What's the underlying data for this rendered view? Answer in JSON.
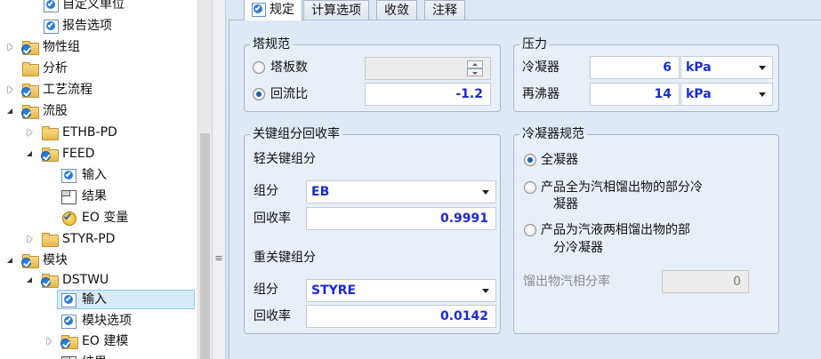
{
  "tree": {
    "items": [
      {
        "label": "自定义单位",
        "icon": "doc-check-icon",
        "expander": "none"
      },
      {
        "label": "报告选项",
        "icon": "doc-check-icon",
        "expander": "none"
      },
      {
        "label": "物性组",
        "icon": "folder-check-icon",
        "expander": "closed"
      },
      {
        "label": "分析",
        "icon": "folder-icon",
        "expander": "none"
      },
      {
        "label": "工艺流程",
        "icon": "folder-check-icon",
        "expander": "closed"
      },
      {
        "label": "流股",
        "icon": "folder-check-icon",
        "expander": "open"
      },
      {
        "label": "ETHB-PD",
        "icon": "folder-icon",
        "expander": "closed"
      },
      {
        "label": "FEED",
        "icon": "folder-check-icon",
        "expander": "open"
      },
      {
        "label": "输入",
        "icon": "doc-check-icon",
        "expander": "none"
      },
      {
        "label": "结果",
        "icon": "results-icon",
        "expander": "none"
      },
      {
        "label": "EO 变量",
        "icon": "eo-check-icon",
        "expander": "none"
      },
      {
        "label": "STYR-PD",
        "icon": "folder-icon",
        "expander": "closed"
      },
      {
        "label": "模块",
        "icon": "folder-check-icon",
        "expander": "open"
      },
      {
        "label": "DSTWU",
        "icon": "folder-check-icon",
        "expander": "open"
      },
      {
        "label": "输入",
        "icon": "doc-check-icon",
        "expander": "none",
        "selected": true
      },
      {
        "label": "模块选项",
        "icon": "doc-check-icon",
        "expander": "none"
      },
      {
        "label": "EO 建模",
        "icon": "folder-check-icon",
        "expander": "closed"
      },
      {
        "label": "结果",
        "icon": "results-icon",
        "expander": "none"
      }
    ]
  },
  "tabs": [
    {
      "label": "规定",
      "active": true,
      "icon": "doc-check-icon"
    },
    {
      "label": "计算选项"
    },
    {
      "label": "收敛"
    },
    {
      "label": "注释"
    }
  ],
  "column_spec": {
    "title": "塔规范",
    "stages_label": "塔板数",
    "stages_value": "",
    "reflux_label": "回流比",
    "reflux_value": "-1.2",
    "selected": "reflux"
  },
  "pressure": {
    "title": "压力",
    "condenser_label": "冷凝器",
    "condenser_value": "6",
    "condenser_unit": "kPa",
    "reboiler_label": "再沸器",
    "reboiler_value": "14",
    "reboiler_unit": "kPa"
  },
  "key_recovery": {
    "title": "关键组分回收率",
    "light_title": "轻关键组分",
    "light_component_label": "组分",
    "light_component": "EB",
    "light_recovery_label": "回收率",
    "light_recovery": "0.9991",
    "heavy_title": "重关键组分",
    "heavy_component_label": "组分",
    "heavy_component": "STYRE",
    "heavy_recovery_label": "回收率",
    "heavy_recovery": "0.0142"
  },
  "condenser_spec": {
    "title": "冷凝器规范",
    "opt_total": "全凝器",
    "opt_partial_vapor_l1": "产品全为汽相馏出物的部分冷",
    "opt_partial_vapor_l2": "凝器",
    "opt_partial_mixed_l1": "产品为汽液两相馏出物的部",
    "opt_partial_mixed_l2": "分冷凝器",
    "distillate_vapor_label": "馏出物汽相分率",
    "distillate_vapor_value": "0",
    "selected": "total"
  },
  "colors": {
    "value_blue": "#1c2bd0",
    "panel_bg": "#dfe9f5",
    "selection": "#d6ecfb"
  }
}
